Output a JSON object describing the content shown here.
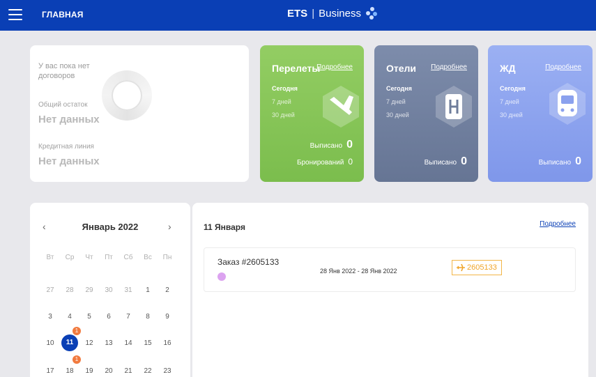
{
  "header": {
    "menu_icon": "hamburger-icon",
    "nav_title": "ГЛАВНАЯ",
    "brand_bold": "ETS",
    "brand_sep": "|",
    "brand_name": "Business",
    "accent": "#0a3fb5"
  },
  "contracts": {
    "no_contracts": "У вас пока нет договоров",
    "balance_label": "Общий остаток",
    "balance_value": "Нет данных",
    "credit_label": "Кредитная линия",
    "credit_value": "Нет данных"
  },
  "services": [
    {
      "title": "Перелеты",
      "more": "Подробнее",
      "today": "Сегодня",
      "week": "7 дней",
      "month": "30 дней",
      "issued_label": "Выписано",
      "issued": "0",
      "booked_label": "Бронирований",
      "booked": "0",
      "icon": "plane-icon",
      "color": "#86c558"
    },
    {
      "title": "Отели",
      "more": "Подробнее",
      "today": "Сегодня",
      "week": "7 дней",
      "month": "30 дней",
      "issued_label": "Выписано",
      "issued": "0",
      "icon": "hotel-icon",
      "color": "#72809f"
    },
    {
      "title": "ЖД",
      "more": "Подробнее",
      "today": "Сегодня",
      "week": "7 дней",
      "month": "30 дней",
      "issued_label": "Выписано",
      "issued": "0",
      "icon": "train-icon",
      "color": "#8da3ef"
    }
  ],
  "calendar": {
    "prev": "‹",
    "next": "›",
    "month": "Январь 2022",
    "weekdays": [
      "Вт",
      "Ср",
      "Чт",
      "Пт",
      "Сб",
      "Вс",
      "Пн"
    ],
    "weeks": [
      [
        "27",
        "28",
        "29",
        "30",
        "31",
        "1",
        "2"
      ],
      [
        "3",
        "4",
        "5",
        "6",
        "7",
        "8",
        "9"
      ],
      [
        "10",
        "11",
        "12",
        "13",
        "14",
        "15",
        "16"
      ],
      [
        "17",
        "18",
        "19",
        "20",
        "21",
        "22",
        "23"
      ]
    ],
    "selected": "11",
    "badges": [
      {
        "day": "11",
        "count": "1"
      },
      {
        "day": "18",
        "count": "1"
      }
    ]
  },
  "orders": {
    "date": "11 Января",
    "more": "Подробнее",
    "items": [
      {
        "number": "Заказ #2605133",
        "range": "28 Янв 2022 - 28 Янв 2022",
        "ticket": "2605133",
        "ticket_icon": "plane-icon"
      }
    ]
  }
}
